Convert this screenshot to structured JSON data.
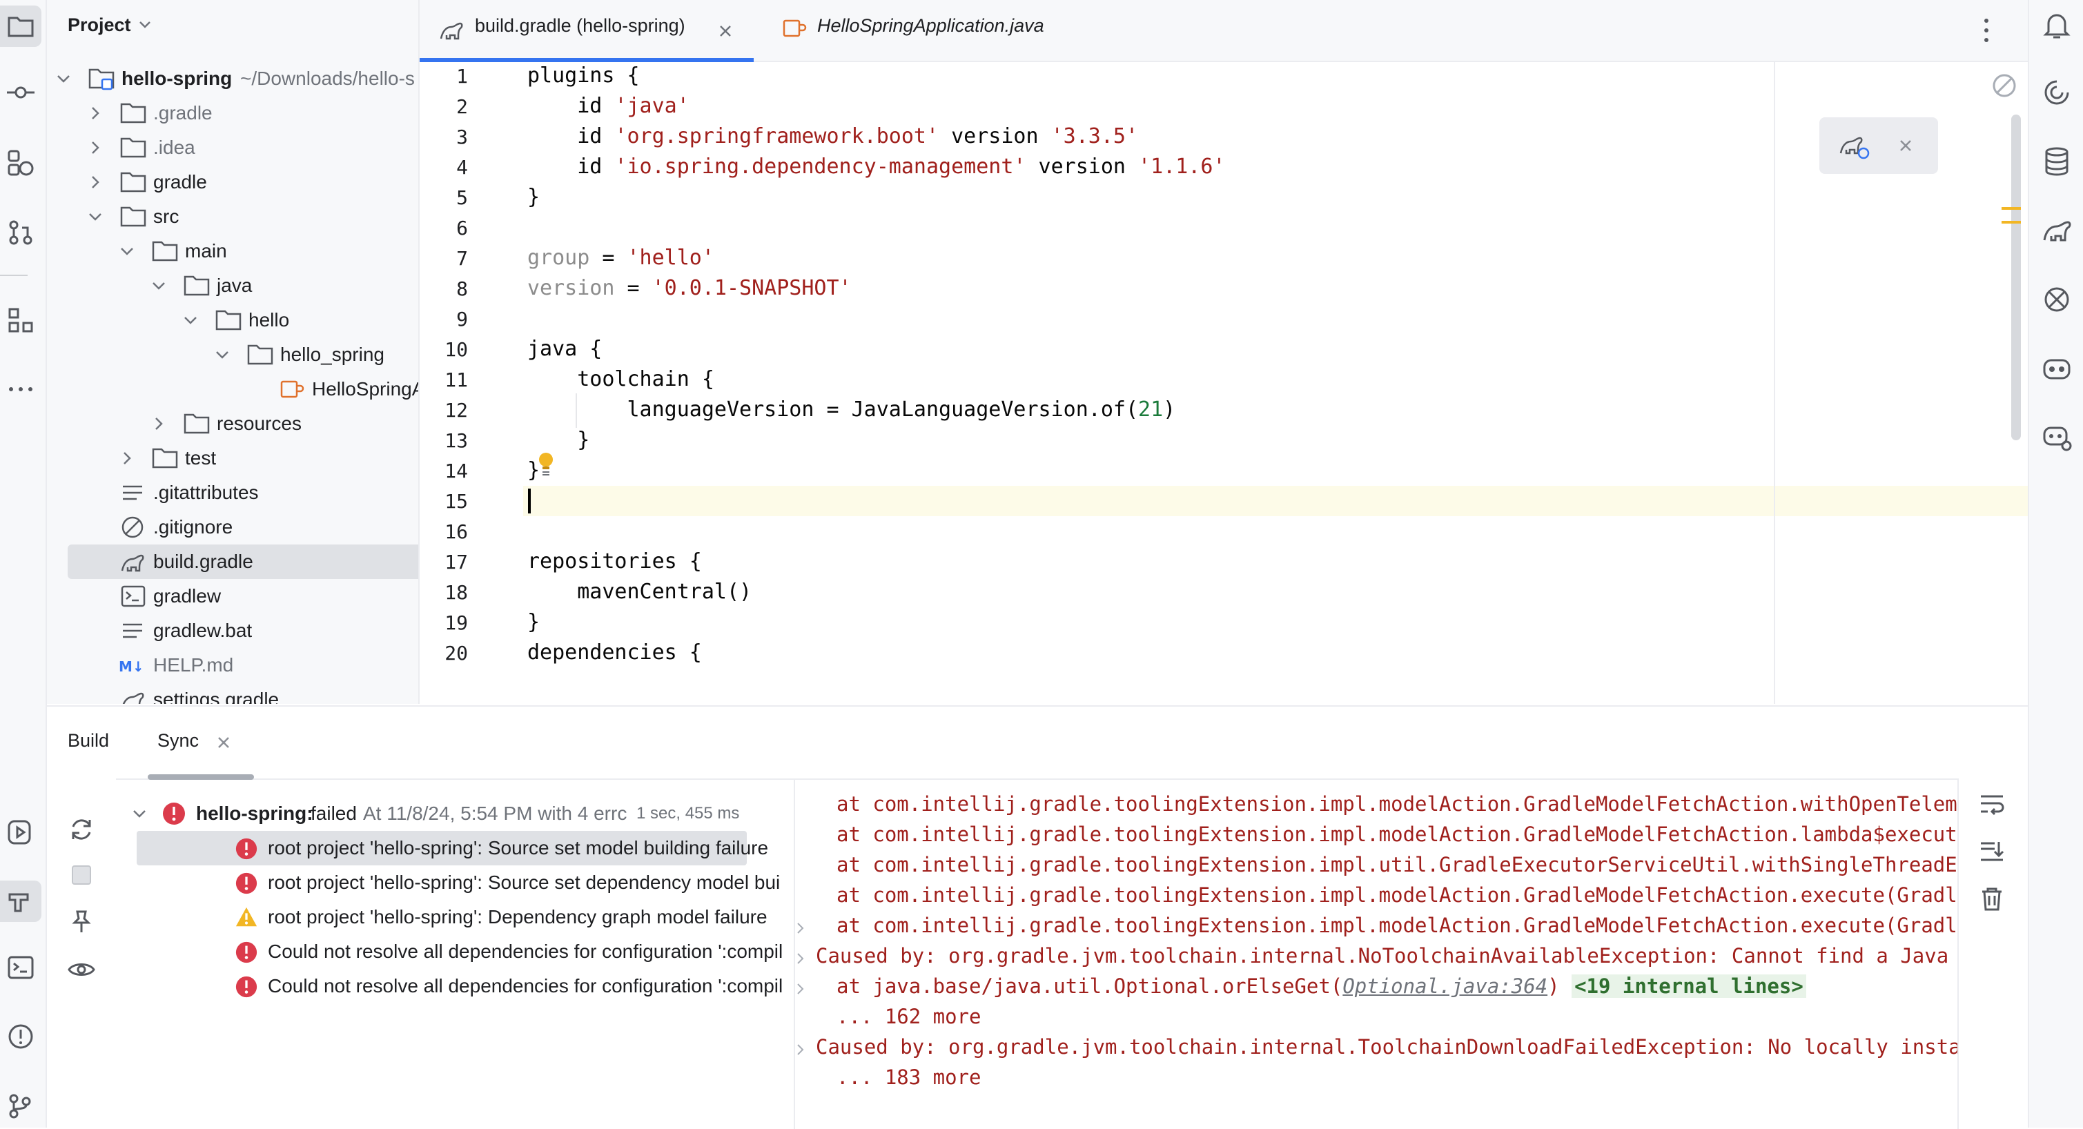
{
  "project_panel": {
    "title": "Project",
    "root": {
      "name": "hello-spring",
      "path": "~/Downloads/hello-s"
    },
    "items": [
      {
        "label": ".gradle",
        "muted": true
      },
      {
        "label": ".idea",
        "muted": true
      },
      {
        "label": "gradle",
        "muted": false
      },
      {
        "label": "src",
        "muted": false
      },
      {
        "label": "main",
        "muted": false
      },
      {
        "label": "java",
        "muted": false
      },
      {
        "label": "hello",
        "muted": false
      },
      {
        "label": "hello_spring",
        "muted": false
      },
      {
        "label": "HelloSpringA",
        "muted": false
      },
      {
        "label": "resources",
        "muted": false
      },
      {
        "label": "test",
        "muted": false
      },
      {
        "label": ".gitattributes",
        "muted": false
      },
      {
        "label": ".gitignore",
        "muted": false
      },
      {
        "label": "build.gradle",
        "muted": false
      },
      {
        "label": "gradlew",
        "muted": false
      },
      {
        "label": "gradlew.bat",
        "muted": false
      },
      {
        "label": "HELP.md",
        "muted": true
      },
      {
        "label": "settings.gradle",
        "muted": false
      }
    ]
  },
  "tabs": [
    {
      "label": "build.gradle (hello-spring)",
      "active": true
    },
    {
      "label": "HelloSpringApplication.java",
      "active": false
    }
  ],
  "editor": {
    "line_numbers": [
      "1",
      "2",
      "3",
      "4",
      "5",
      "6",
      "7",
      "8",
      "9",
      "10",
      "11",
      "12",
      "13",
      "14",
      "15",
      "16",
      "17",
      "18",
      "19",
      "20"
    ],
    "lines": {
      "l1": "plugins {",
      "l2a": "    id ",
      "l2b": "'java'",
      "l3a": "    id ",
      "l3b": "'org.springframework.boot'",
      "l3c": " version ",
      "l3d": "'3.3.5'",
      "l4a": "    id ",
      "l4b": "'io.spring.dependency-management'",
      "l4c": " version ",
      "l4d": "'1.1.6'",
      "l5": "}",
      "l7a": "group",
      "l7b": " = ",
      "l7c": "'hello'",
      "l8a": "version",
      "l8b": " = ",
      "l8c": "'0.0.1-SNAPSHOT'",
      "l10": "java {",
      "l11": "    toolchain {",
      "l12a": "        languageVersion = JavaLanguageVersion.of(",
      "l12b": "21",
      "l12c": ")",
      "l13": "    }",
      "l14": "}",
      "l16": "repositories {",
      "l17": "    mavenCentral()",
      "l18": "}",
      "l20": "dependencies {"
    }
  },
  "build_panel": {
    "tabs": {
      "build": "Build",
      "sync": "Sync"
    },
    "root": {
      "name": "hello-spring:",
      "status": "failed",
      "detail": "At 11/8/24, 5:54 PM with 4 errc",
      "duration": "1 sec, 455 ms"
    },
    "items": [
      {
        "type": "error",
        "label": "root project 'hello-spring': Source set model building failure"
      },
      {
        "type": "error",
        "label": "root project 'hello-spring': Source set dependency model bui"
      },
      {
        "type": "warning",
        "label": "root project 'hello-spring': Dependency graph model failure"
      },
      {
        "type": "error",
        "label": "Could not resolve all dependencies for configuration ':compil"
      },
      {
        "type": "error",
        "label": "Could not resolve all dependencies for configuration ':compil"
      }
    ],
    "console": {
      "c1": "at com.intellij.gradle.toolingExtension.impl.modelAction.GradleModelFetchAction.withOpenTeleme",
      "c2": "at com.intellij.gradle.toolingExtension.impl.modelAction.GradleModelFetchAction.lambda$execute",
      "c3": "at com.intellij.gradle.toolingExtension.impl.util.GradleExecutorServiceUtil.withSingleThreadEx",
      "c4": "at com.intellij.gradle.toolingExtension.impl.modelAction.GradleModelFetchAction.execute(Gradle",
      "c5": "at com.intellij.gradle.toolingExtension.impl.modelAction.GradleModelFetchAction.execute(Gradle",
      "c6": "Caused by: org.gradle.jvm.toolchain.internal.NoToolchainAvailableException: Cannot find a Java i",
      "c7a": "at java.base/java.util.Optional.orElseGet(",
      "c7b": "Optional.java:364",
      "c7c": ")",
      "c7d": "<19 internal lines>",
      "c8": "... 162 more",
      "c9": "Caused by: org.gradle.jvm.toolchain.internal.ToolchainDownloadFailedException: No locally instal",
      "c10": "... 183 more"
    }
  },
  "colors": {
    "accent": "#3574f0",
    "error": "#db3b4b",
    "warning": "#f2b624",
    "string": "#a0201c",
    "number": "#1750eb"
  }
}
